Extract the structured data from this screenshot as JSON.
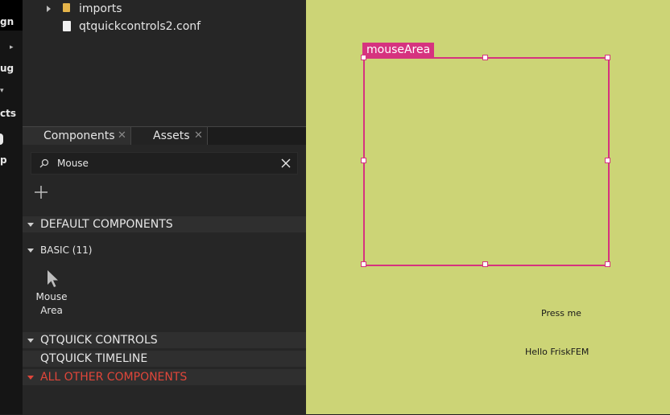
{
  "mode_bar": {
    "items": [
      "gn",
      "ug",
      "cts",
      "p"
    ]
  },
  "file_tree": {
    "items": [
      {
        "label": "imports",
        "icon": "folder-icon"
      },
      {
        "label": "qtquickcontrols2.conf",
        "icon": "file-icon"
      }
    ]
  },
  "components_panel": {
    "tabs": [
      {
        "label": "Components",
        "active": true
      },
      {
        "label": "Assets",
        "active": false
      }
    ],
    "search": {
      "value": "Mouse"
    },
    "sections": {
      "default_components": "DEFAULT COMPONENTS",
      "basic": "BASIC (11)",
      "qtquick_controls": "QTQUICK CONTROLS",
      "qtquick_timeline": "QTQUICK TIMELINE",
      "all_other": "ALL OTHER COMPONENTS"
    },
    "items": [
      {
        "label_line1": "Mouse",
        "label_line2": "Area",
        "icon": "cursor-icon"
      }
    ],
    "colors": {
      "all_other": "#e0463a"
    }
  },
  "canvas": {
    "selection_label": "mouseArea",
    "press_text": "Press me",
    "hello_text": "Hello FriskFEM",
    "colors": {
      "background": "#ccd476",
      "selection": "#d6337f"
    }
  }
}
